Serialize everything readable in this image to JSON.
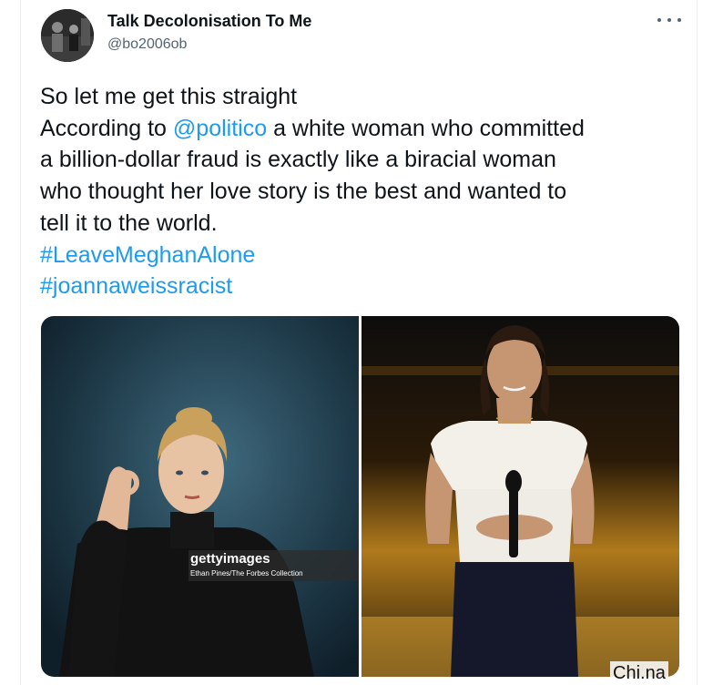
{
  "tweet": {
    "author_name": "Talk Decolonisation To Me",
    "author_handle": "@bo2006ob",
    "more_icon": "more-horizontal-icon",
    "line1": "So let me get this straight",
    "line2_prefix": "According to ",
    "line2_mention": "@politico",
    "line2_suffix": " a white woman who committed",
    "line3": "a billion-dollar fraud is exactly like a biracial woman",
    "line4": "who thought her love story is the best and wanted to",
    "line5": "tell it to the world.",
    "hashtag1": "#LeaveMeghanAlone",
    "hashtag2": "#joannaweissracist"
  },
  "media": {
    "left_photo_watermark": "gettyimages",
    "left_photo_credit": "Ethan Pines/The Forbes Collection"
  },
  "overlay": {
    "site_tag": "Chi.na"
  },
  "colors": {
    "link": "#1d9bf0",
    "text": "#0f1419",
    "secondary": "#536471"
  }
}
